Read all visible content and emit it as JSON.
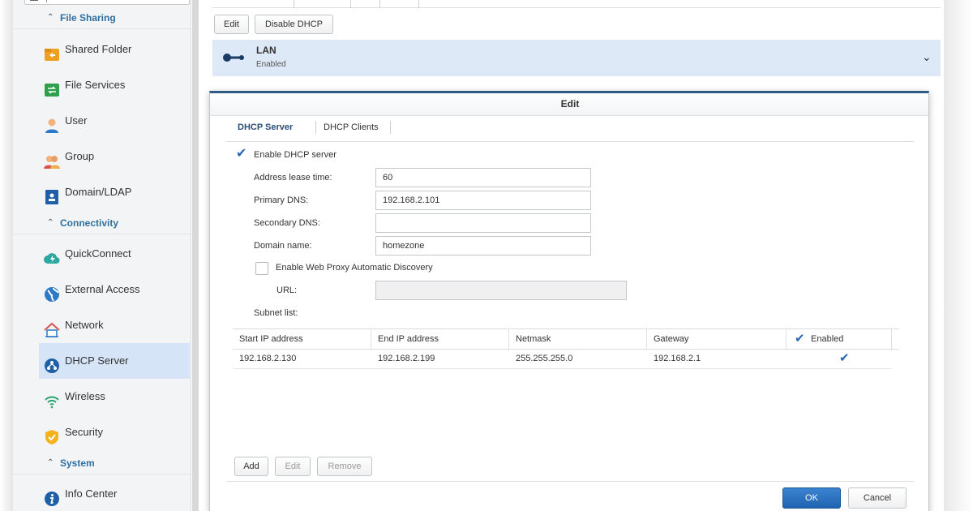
{
  "sidebar": {
    "sections": [
      {
        "label": "File Sharing"
      },
      {
        "label": "Connectivity"
      },
      {
        "label": "System"
      }
    ],
    "items": [
      {
        "label": "Shared Folder"
      },
      {
        "label": "File Services"
      },
      {
        "label": "User"
      },
      {
        "label": "Group"
      },
      {
        "label": "Domain/LDAP"
      },
      {
        "label": "QuickConnect"
      },
      {
        "label": "External Access"
      },
      {
        "label": "Network"
      },
      {
        "label": "DHCP Server"
      },
      {
        "label": "Wireless"
      },
      {
        "label": "Security"
      },
      {
        "label": "Info Center"
      }
    ],
    "active": "DHCP Server"
  },
  "toolbar": {
    "edit_label": "Edit",
    "disable_label": "Disable DHCP"
  },
  "lan": {
    "title": "LAN",
    "status": "Enabled"
  },
  "dialog": {
    "title": "Edit",
    "tabs": [
      {
        "label": "DHCP Server"
      },
      {
        "label": "DHCP Clients"
      }
    ],
    "enable_dhcp_label": "Enable DHCP server",
    "enable_dhcp_checked": true,
    "fields": {
      "lease_label": "Address lease time:",
      "lease_value": "60",
      "primary_dns_label": "Primary DNS:",
      "primary_dns_value": "192.168.2.101",
      "secondary_dns_label": "Secondary DNS:",
      "secondary_dns_value": "",
      "domain_label": "Domain name:",
      "domain_value": "homezone",
      "wpad_label": "Enable Web Proxy Automatic Discovery",
      "wpad_checked": false,
      "url_label": "URL:",
      "url_value": "",
      "subnet_label": "Subnet list:"
    },
    "grid": {
      "columns": [
        "Start IP address",
        "End IP address",
        "Netmask",
        "Gateway",
        "Enabled"
      ],
      "rows": [
        {
          "start": "192.168.2.130",
          "end": "192.168.2.199",
          "netmask": "255.255.255.0",
          "gateway": "192.168.2.1",
          "enabled": true
        }
      ]
    },
    "grid_buttons": {
      "add": "Add",
      "edit": "Edit",
      "remove": "Remove"
    },
    "ok_label": "OK",
    "cancel_label": "Cancel"
  },
  "colors": {
    "accent": "#2a64b6",
    "active_bg": "#d6e4f7",
    "lan_bar": "#dde9f7",
    "section_text": "#2f6f9f",
    "dialog_border_top": "#2d5d87"
  }
}
